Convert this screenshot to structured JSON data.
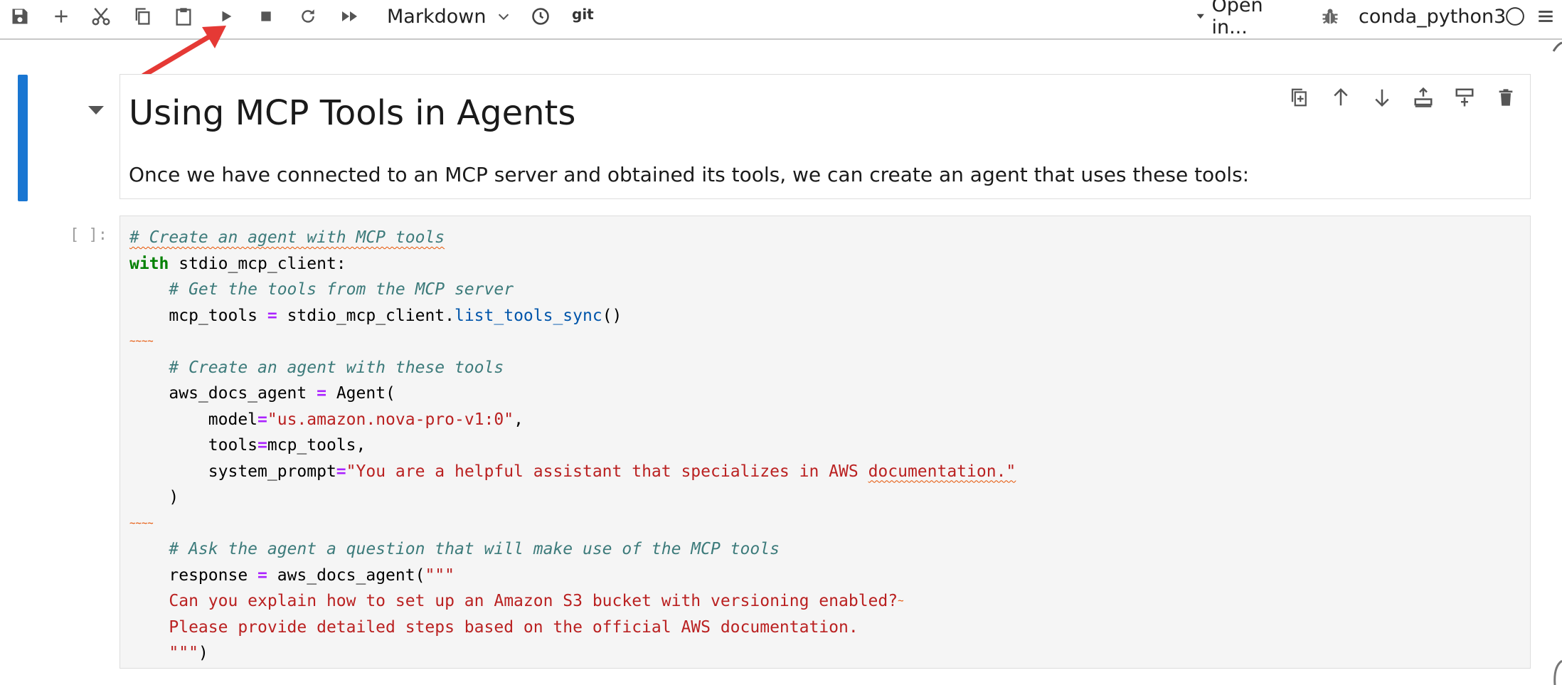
{
  "toolbar": {
    "kernel_dropdown_label": "Markdown",
    "git_label": "git",
    "open_in_label": "Open in...",
    "kernel_name": "conda_python3",
    "icons": [
      "save-icon",
      "add-icon",
      "cut-icon",
      "copy-icon",
      "paste-icon",
      "run-icon",
      "stop-icon",
      "restart-icon",
      "fast-forward-icon",
      "clock-icon",
      "bug-icon",
      "kernel-status-icon",
      "menu-icon"
    ]
  },
  "markdown_cell": {
    "title": "Using MCP Tools in Agents",
    "paragraph": "Once we have connected to an MCP server and obtained its tools, we can create an agent that uses these tools:",
    "tools": [
      "duplicate-icon",
      "move-up-icon",
      "move-down-icon",
      "insert-above-icon",
      "insert-below-icon",
      "delete-icon"
    ]
  },
  "code_cell": {
    "prompt": "[ ]:",
    "tokens": {
      "l1_comment": "# Create an agent with MCP tools",
      "l2_kw": "with",
      "l2_rest": " stdio_mcp_client:",
      "l3_comment": "# Get the tools from the MCP server",
      "l4_a": "mcp_tools ",
      "l4_op": "=",
      "l4_b": " stdio_mcp_client.",
      "l4_method": "list_tools_sync",
      "l4_c": "()",
      "l5_mark": "~~~~",
      "l6_comment": "# Create an agent with these tools",
      "l7_a": "aws_docs_agent ",
      "l7_op": "=",
      "l7_b": " Agent(",
      "l8_a": "model",
      "l8_op": "=",
      "l8_str": "\"us.amazon.nova-pro-v1:0\"",
      "l8_c": ",",
      "l9_a": "tools",
      "l9_op": "=",
      "l9_b": "mcp_tools,",
      "l10_a": "system_prompt",
      "l10_op": "=",
      "l10_str_a": "\"You are a helpful assistant that specializes in AWS ",
      "l10_str_b": "documentation.\"",
      "l11": ")",
      "l12_mark": "~~~~",
      "l13_comment": "# Ask the agent a question that will make use of the MCP tools",
      "l14_a": "response ",
      "l14_op": "=",
      "l14_b": " aws_docs_agent(",
      "l14_str": "\"\"\"",
      "l15_str": "Can you explain how to set up an Amazon S3 bucket with versioning enabled?",
      "l15_mark": "~",
      "l16_str": "Please provide detailed steps based on the official AWS documentation.",
      "l17_str": "\"\"\"",
      "l17_b": ")"
    }
  },
  "colors": {
    "accent_blue": "#1976d2",
    "comment": "#3d7b7b",
    "keyword": "#008000",
    "operator": "#aa22ff",
    "string": "#ba2121",
    "annotation_arrow": "#e53935"
  }
}
